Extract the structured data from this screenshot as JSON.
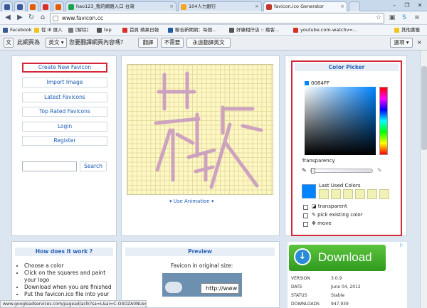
{
  "browser": {
    "tabs": [
      {
        "label": "",
        "fav_color": "#3b5998"
      },
      {
        "label": "",
        "fav_color": "#3b5998"
      },
      {
        "label": "",
        "fav_color": "#e65c00"
      },
      {
        "label": "",
        "fav_color": "#d93025"
      },
      {
        "label": "",
        "fav_color": "#e65c00"
      },
      {
        "label": "hao123_我的網路入口 台灣",
        "fav_color": "#1aa34a"
      },
      {
        "label": "104人力銀行",
        "fav_color": "#f5a623"
      },
      {
        "label": "favicon.ico Generator",
        "fav_color": "#c0392b"
      }
    ],
    "url": "www.favicon.cc",
    "window_controls": [
      "–",
      "❐",
      "✕"
    ],
    "bookmarks": [
      {
        "label": "Facebook",
        "color": "#3b5998"
      },
      {
        "label": "從 IE 匯入",
        "color": "#f0c419"
      },
      {
        "label": "[解除]",
        "color": "#7a7a7a"
      },
      {
        "label": "top",
        "color": "#555"
      },
      {
        "label": "首頁 蘋果日報",
        "color": "#d93025"
      },
      {
        "label": "聯合新聞網：每個...",
        "color": "#1e5aa8"
      },
      {
        "label": "好康相仔店 :: 癮客...",
        "color": "#555"
      },
      {
        "label": "youtube.com-watchv=...",
        "color": "#d93025"
      },
      {
        "label": "其他書籤",
        "color": "#f0c419"
      }
    ]
  },
  "translate_bar": {
    "prefix": "此網頁為",
    "language": "英文",
    "question": "您要翻譯網頁內容嗎？",
    "translate": "翻譯",
    "no": "不需要",
    "never": "永遠翻譯英文",
    "options": "選項"
  },
  "sidebar": {
    "items": [
      "Create New Favicon",
      "Import Image",
      "Latest Favicons",
      "Top Rated Favicons",
      "Login",
      "Register"
    ],
    "search_button": "Search",
    "search_value": ""
  },
  "editor": {
    "use_animation": "Use Animation",
    "cell_color": "#fdf7c4",
    "stroke_color": "#c99ac0"
  },
  "color_picker": {
    "title": "Color Picker",
    "hex": "0084FF",
    "transparency_label": "Transparency",
    "last_used_label": "Last Used Colors",
    "current_color": "#0084ff",
    "options": [
      "transparent",
      "pick existing color",
      "move"
    ]
  },
  "how_it_works": {
    "title": "How does it work ?",
    "steps": [
      "Choose a color",
      "Click on the squares and paint your logo",
      "Download when you are finished",
      "Put the favicon.ico file into your"
    ]
  },
  "preview": {
    "title": "Preview",
    "text": "Favicon in original size:",
    "url_text": "http://www"
  },
  "download_ad": {
    "button": "Download",
    "meta": [
      {
        "key": "VERSION",
        "value": "3.0.9"
      },
      {
        "key": "DATE",
        "value": "June 04, 2012"
      },
      {
        "key": "STATUS",
        "value": "Stable"
      },
      {
        "key": "DOWNLOADS",
        "value": "947,939"
      }
    ]
  },
  "status_bar": "www.googleadservices.com/pagead/aclk?sa=L&ai=C-O4OZA0NUeyr..."
}
